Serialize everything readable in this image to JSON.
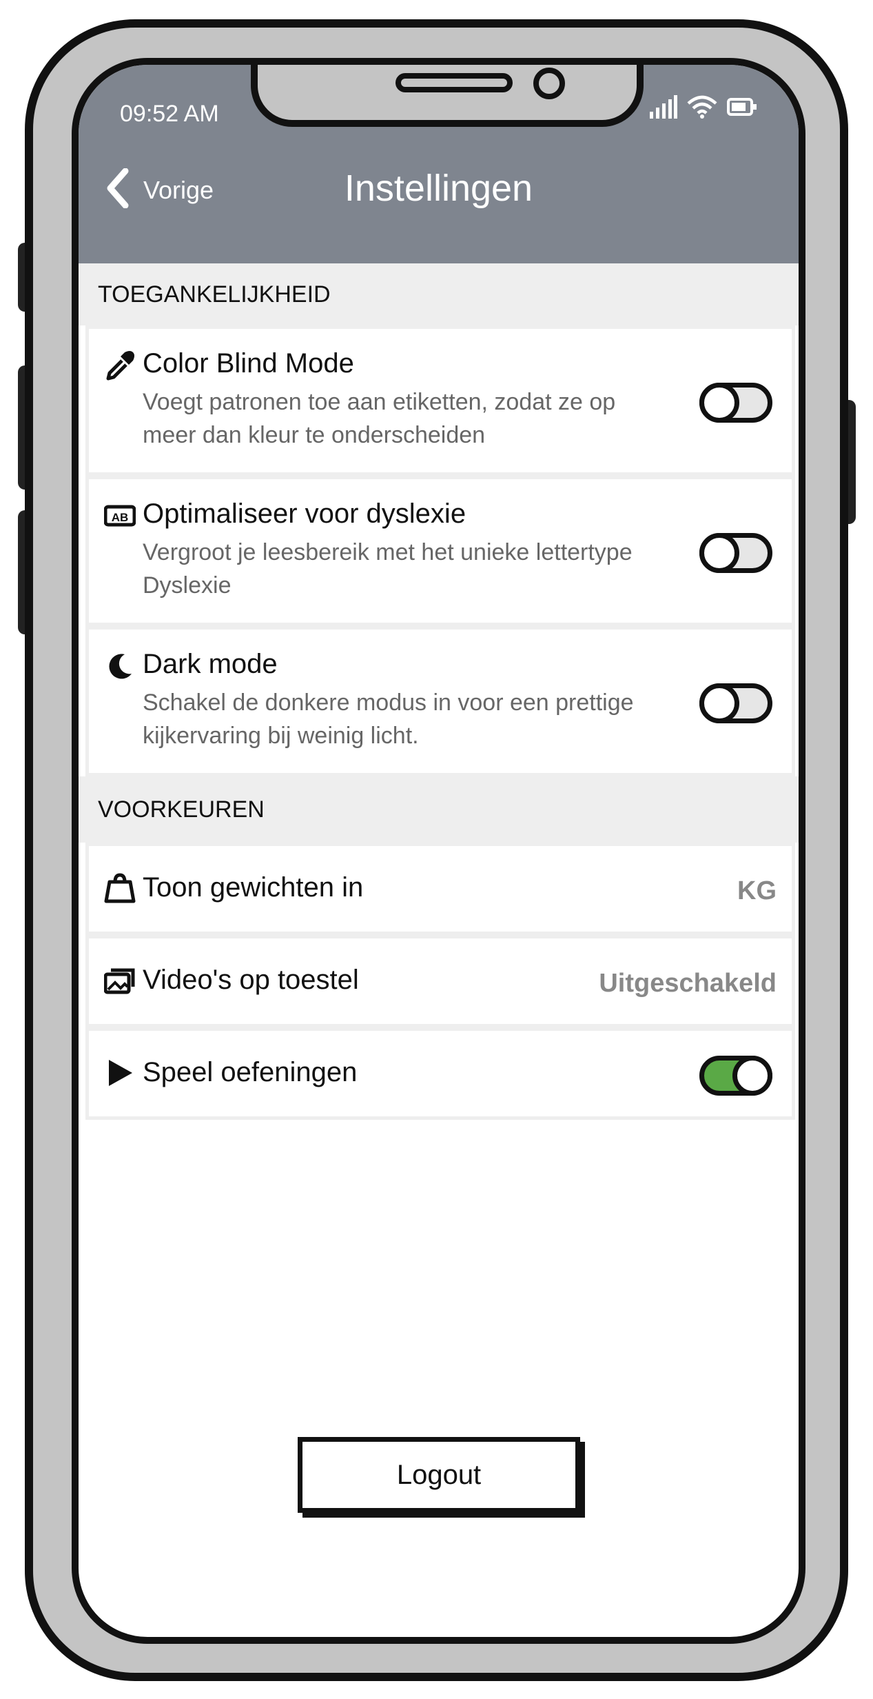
{
  "status_bar": {
    "time": "09:52 AM"
  },
  "nav": {
    "back_label": "Vorige",
    "title": "Instellingen"
  },
  "sections": [
    {
      "header": "TOEGANKELIJKHEID",
      "items": [
        {
          "icon": "eyedropper-icon",
          "title": "Color Blind Mode",
          "description": "Voegt patronen toe aan etiketten, zodat ze op meer dan kleur te onderscheiden",
          "toggle": false
        },
        {
          "icon": "dyslexia-ab-icon",
          "title": "Optimaliseer voor dyslexie",
          "description": "Vergroot je leesbereik met het unieke lettertype Dyslexie",
          "toggle": false
        },
        {
          "icon": "moon-icon",
          "title": "Dark mode",
          "description": "Schakel de donkere modus in voor een prettige kijkervaring bij weinig licht.",
          "toggle": false
        }
      ]
    },
    {
      "header": "VOORKEUREN",
      "items": [
        {
          "icon": "weight-icon",
          "title": "Toon gewichten in",
          "value": "KG"
        },
        {
          "icon": "video-icon",
          "title": "Video's op toestel",
          "value": "Uitgeschakeld"
        },
        {
          "icon": "play-icon",
          "title": "Speel oefeningen",
          "toggle": true
        }
      ]
    }
  ],
  "logout_label": "Logout",
  "colors": {
    "header_bg": "#7f858f",
    "toggle_on": "#5aa946",
    "section_bg": "#eeeeee"
  }
}
